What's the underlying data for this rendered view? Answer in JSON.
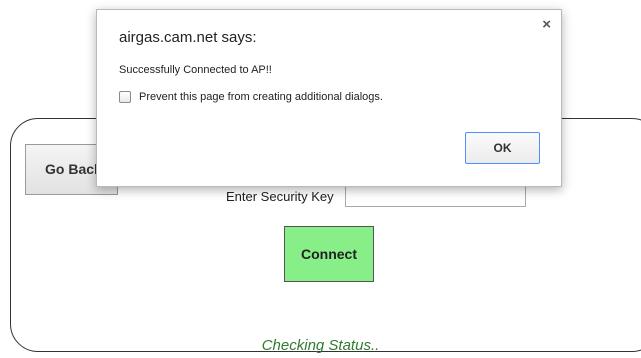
{
  "page": {
    "go_back_label": "Go Back",
    "security_key_label": "Enter Security Key",
    "security_key_value": "",
    "connect_label": "Connect",
    "status_text": "Checking Status.."
  },
  "dialog": {
    "title": "airgas.cam.net says:",
    "close_glyph": "×",
    "message": "Successfully Connected to AP!!",
    "prevent_label": "Prevent this page from creating additional dialogs.",
    "prevent_checked": false,
    "ok_label": "OK"
  },
  "colors": {
    "connect_button": "#88ee88",
    "status_text": "#2f7b2f",
    "ok_focus_border": "#4d90fe"
  }
}
